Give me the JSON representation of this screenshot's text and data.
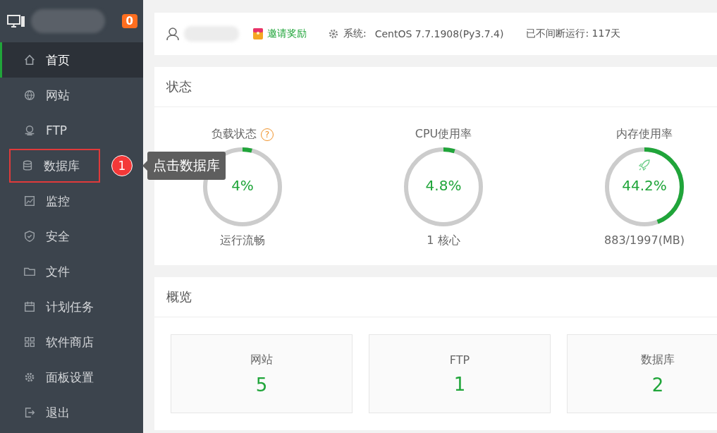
{
  "sidebar": {
    "badge": "0",
    "items": [
      {
        "label": "首页",
        "kind": "home",
        "selected": true,
        "highlighted": false
      },
      {
        "label": "网站",
        "kind": "globe",
        "selected": false,
        "highlighted": false
      },
      {
        "label": "FTP",
        "kind": "ftp",
        "selected": false,
        "highlighted": false
      },
      {
        "label": "数据库",
        "kind": "db",
        "selected": false,
        "highlighted": true
      },
      {
        "label": "监控",
        "kind": "monitor",
        "selected": false,
        "highlighted": false
      },
      {
        "label": "安全",
        "kind": "shield",
        "selected": false,
        "highlighted": false
      },
      {
        "label": "文件",
        "kind": "folder",
        "selected": false,
        "highlighted": false
      },
      {
        "label": "计划任务",
        "kind": "calendar",
        "selected": false,
        "highlighted": false
      },
      {
        "label": "软件商店",
        "kind": "apps",
        "selected": false,
        "highlighted": false
      },
      {
        "label": "面板设置",
        "kind": "gear",
        "selected": false,
        "highlighted": false
      },
      {
        "label": "退出",
        "kind": "exit",
        "selected": false,
        "highlighted": false
      }
    ]
  },
  "callout": {
    "step": "1",
    "text": "点击数据库"
  },
  "topbar": {
    "invite": "邀请奖励",
    "system_label": "系统:",
    "system": "CentOS 7.7.1908(Py3.7.4)",
    "uptime": "已不间断运行: 117天"
  },
  "status": {
    "title": "状态",
    "gauges": [
      {
        "kind": "load",
        "title": "负载状态",
        "help": "?",
        "value": "4%",
        "level": 0.04,
        "caption": "运行流畅"
      },
      {
        "kind": "cpu",
        "title": "CPU使用率",
        "value": "4.8%",
        "level": 0.048,
        "caption": "1 核心"
      },
      {
        "kind": "memory",
        "title": "内存使用率",
        "value": "44.2%",
        "level": 0.442,
        "caption": "883/1997(MB)"
      }
    ]
  },
  "overview": {
    "title": "概览",
    "tiles": [
      {
        "label": "网站",
        "count": "5"
      },
      {
        "label": "FTP",
        "count": "1"
      },
      {
        "label": "数据库",
        "count": "2"
      }
    ]
  }
}
